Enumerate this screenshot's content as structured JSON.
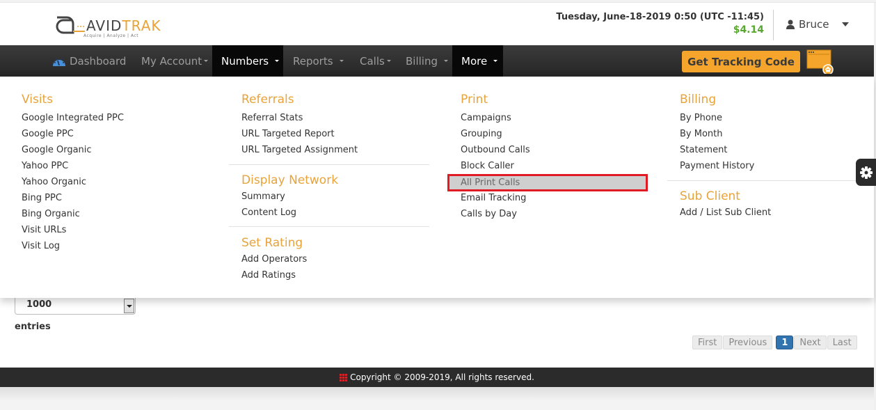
{
  "header": {
    "logo": {
      "brand_a": "AVID",
      "brand_b": "TRAK",
      "tagline": "Acquire  |  Analyze  |  Act"
    },
    "datetime": "Tuesday, June-18-2019 0:50 (UTC -11:45)",
    "balance": "$4.14",
    "user": {
      "name": "Bruce",
      "icon": "user-icon"
    }
  },
  "navbar": {
    "items": [
      {
        "label": "Dashboard",
        "icon": "dashboard-gauge-icon"
      },
      {
        "label": "My Account"
      },
      {
        "label": "Numbers"
      },
      {
        "label": "Reports"
      },
      {
        "label": "Calls"
      },
      {
        "label": "Billing"
      },
      {
        "label": "More"
      }
    ],
    "active": [
      "Numbers",
      "More"
    ],
    "tracking_button": "Get Tracking Code",
    "colors": {
      "accent": "#f5a52b",
      "nav_bg": "#262626"
    }
  },
  "mega_menu": {
    "columns": [
      {
        "sections": [
          {
            "title": "Visits",
            "links": [
              "Google Integrated PPC",
              "Google PPC",
              "Google Organic",
              "Yahoo PPC",
              "Yahoo Organic",
              "Bing PPC",
              "Bing Organic",
              "Visit URLs",
              "Visit Log"
            ]
          }
        ]
      },
      {
        "sections": [
          {
            "title": "Referrals",
            "links": [
              "Referral Stats",
              "URL Targeted Report",
              "URL Targeted Assignment"
            ]
          },
          {
            "title": "Display Network",
            "links": [
              "Summary",
              "Content Log"
            ]
          },
          {
            "title": "Set Rating",
            "links": [
              "Add Operators",
              "Add Ratings"
            ]
          }
        ]
      },
      {
        "sections": [
          {
            "title": "Print",
            "links": [
              "Campaigns",
              "Grouping",
              "Outbound Calls",
              "Block Caller",
              "All Print Calls",
              "Email Tracking",
              "Calls by Day"
            ]
          }
        ]
      },
      {
        "sections": [
          {
            "title": "Billing",
            "links": [
              "By Phone",
              "By Month",
              "Statement",
              "Payment History"
            ]
          },
          {
            "title": "Sub Client",
            "links": [
              "Add / List Sub Client"
            ]
          }
        ]
      }
    ],
    "highlighted_item": "All Print Calls",
    "section_title_color": "#e8a33a",
    "highlight_border_color": "#e01b24"
  },
  "content": {
    "page_length_value": "1000",
    "entries_label": "entries",
    "pagination": {
      "first": "First",
      "previous": "Previous",
      "current": "1",
      "next": "Next",
      "last": "Last"
    }
  },
  "footer": {
    "copyright": "Copyright © 2009-2019, All rights reserved."
  }
}
